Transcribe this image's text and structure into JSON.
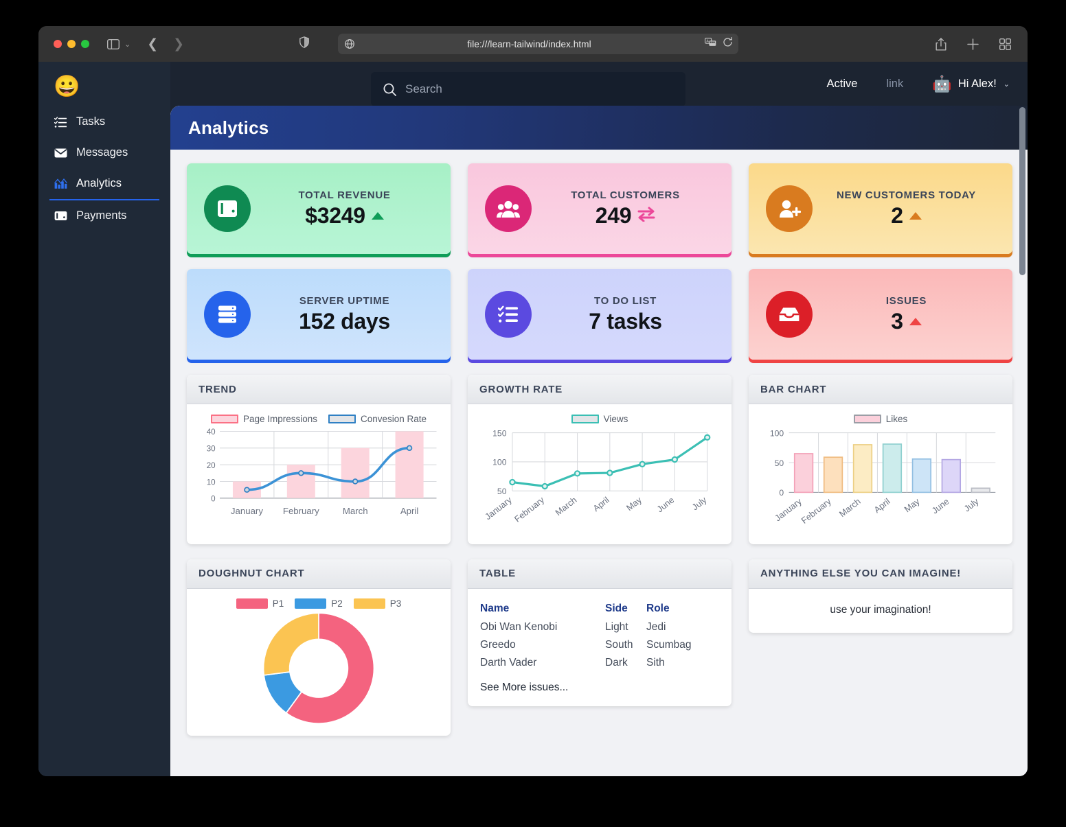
{
  "browser": {
    "url": "file:///learn-tailwind/index.html",
    "icons": {
      "sidebar": "sidebar-toggle-icon",
      "back": "back-arrow-icon",
      "forward": "forward-arrow-icon",
      "shield": "shield-privacy-icon",
      "globe": "globe-icon",
      "translate": "translate-icon",
      "reload": "reload-icon",
      "share": "share-icon",
      "new_tab": "plus-icon",
      "tab_overview": "tab-overview-icon"
    }
  },
  "sidebar": {
    "logo": "😀",
    "items": [
      {
        "label": "Tasks",
        "icon": "tasks-list-icon",
        "active": false
      },
      {
        "label": "Messages",
        "icon": "envelope-icon",
        "active": false
      },
      {
        "label": "Analytics",
        "icon": "chart-bar-icon",
        "active": true
      },
      {
        "label": "Payments",
        "icon": "wallet-icon",
        "active": false
      }
    ]
  },
  "topbar": {
    "search_placeholder": "Search",
    "search_value": "",
    "links": [
      {
        "label": "Active",
        "muted": false
      },
      {
        "label": "link",
        "muted": true
      }
    ],
    "user": {
      "avatar": "🤖",
      "greeting": "Hi Alex!",
      "caret": "⌄"
    }
  },
  "page": {
    "title": "Analytics"
  },
  "stats": [
    {
      "label": "TOTAL REVENUE",
      "value": "$3249",
      "icon": "wallet-icon",
      "indicator": "triangle-up",
      "bg_from": "#a7f0c6",
      "bg_to": "#b8f5d6",
      "icon_bg": "#0f8a52",
      "accent": "#0f9d58",
      "bar": "#0f9d58"
    },
    {
      "label": "TOTAL CUSTOMERS",
      "value": "249",
      "icon": "users-icon",
      "indicator": "exchange",
      "bg_from": "#f9c7dd",
      "bg_to": "#fbd6e6",
      "icon_bg": "#db2777",
      "accent": "#ec4899",
      "bar": "#ec4899"
    },
    {
      "label": "NEW CUSTOMERS TODAY",
      "value": "2",
      "icon": "user-plus-icon",
      "indicator": "triangle-up",
      "bg_from": "#fbd98a",
      "bg_to": "#fbe6b0",
      "icon_bg": "#d97b1f",
      "accent": "#d97b1f",
      "bar": "#d97b1f"
    },
    {
      "label": "SERVER UPTIME",
      "value": "152 days",
      "icon": "server-icon",
      "indicator": "none",
      "bg_from": "#bcdcfb",
      "bg_to": "#cfe4fd",
      "icon_bg": "#2563eb",
      "accent": "#2563eb",
      "bar": "#2563eb"
    },
    {
      "label": "TO DO LIST",
      "value": "7 tasks",
      "icon": "checklist-icon",
      "indicator": "none",
      "bg_from": "#cdd3fb",
      "bg_to": "#d5d9fd",
      "icon_bg": "#5b4ae0",
      "accent": "#5b4ae0",
      "bar": "#5b4ae0"
    },
    {
      "label": "ISSUES",
      "value": "3",
      "icon": "inbox-icon",
      "indicator": "triangle-up",
      "bg_from": "#fbb8b8",
      "bg_to": "#fcd2d0",
      "icon_bg": "#dc1f28",
      "accent": "#ef4444",
      "bar": "#ef4444"
    }
  ],
  "panels": {
    "trend": "TREND",
    "growth": "GROWTH RATE",
    "bar": "BAR CHART",
    "doughnut": "DOUGHNUT CHART",
    "table": "TABLE",
    "imagine": "ANYTHING ELSE YOU CAN IMAGINE!"
  },
  "imagine": {
    "text": "use your imagination!"
  },
  "table": {
    "headers": [
      "Name",
      "Side",
      "Role"
    ],
    "rows": [
      [
        "Obi Wan Kenobi",
        "Light",
        "Jedi"
      ],
      [
        "Greedo",
        "South",
        "Scumbag"
      ],
      [
        "Darth Vader",
        "Dark",
        "Sith"
      ]
    ],
    "see_more": "See More issues..."
  },
  "chart_data": [
    {
      "type": "bar",
      "title": "TREND",
      "categories": [
        "January",
        "February",
        "March",
        "April"
      ],
      "series": [
        {
          "name": "Page Impressions",
          "type": "bar",
          "values": [
            10,
            20,
            30,
            40
          ],
          "color": "#fcd5dd",
          "border": "#fb7185"
        },
        {
          "name": "Convesion Rate",
          "type": "line",
          "values": [
            5,
            15,
            10,
            30
          ],
          "color": "#3b92d6",
          "border": "#2f80c4"
        }
      ],
      "ylim": [
        0,
        40
      ],
      "yticks": [
        0,
        10,
        20,
        30,
        40
      ],
      "xlabel": "",
      "ylabel": "",
      "grid": true,
      "legend": "top"
    },
    {
      "type": "line",
      "title": "GROWTH RATE",
      "categories": [
        "January",
        "February",
        "March",
        "April",
        "May",
        "June",
        "July"
      ],
      "series": [
        {
          "name": "Views",
          "values": [
            65,
            58,
            80,
            81,
            96,
            104,
            142
          ],
          "color": "#3bbfb4"
        }
      ],
      "ylim": [
        50,
        150
      ],
      "yticks": [
        50,
        100,
        150
      ],
      "xlabel": "",
      "ylabel": "",
      "grid": true,
      "legend": "top"
    },
    {
      "type": "bar",
      "title": "BAR CHART",
      "categories": [
        "January",
        "February",
        "March",
        "April",
        "May",
        "June",
        "July"
      ],
      "series": [
        {
          "name": "Likes",
          "values": [
            65,
            59,
            80,
            81,
            56,
            55,
            7
          ],
          "colors": [
            "#fbd0db",
            "#fde0bd",
            "#fcecc4",
            "#ccecec",
            "#cde4f7",
            "#ddd6f8",
            "#e8e9ec"
          ],
          "borders": [
            "#f3a0b7",
            "#f0bb80",
            "#eccf83",
            "#8fd0cf",
            "#92bfe2",
            "#b3a6e3",
            "#b9bcc4"
          ]
        }
      ],
      "ylim": [
        0,
        100
      ],
      "yticks": [
        0,
        50,
        100
      ],
      "xlabel": "",
      "ylabel": "",
      "grid": true,
      "legend": "top"
    },
    {
      "type": "pie",
      "title": "DOUGHNUT CHART",
      "labels": [
        "P1",
        "P2",
        "P3"
      ],
      "values": [
        60,
        13,
        27
      ],
      "colors": [
        "#f4637f",
        "#3b9ae1",
        "#fbc452"
      ],
      "legend": "top",
      "grid": false
    }
  ]
}
